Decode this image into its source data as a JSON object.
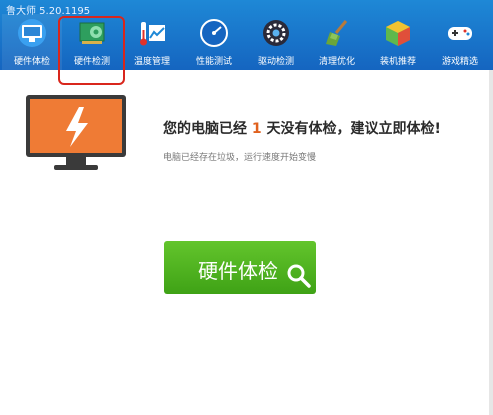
{
  "app": {
    "title": "鲁大师 5.20.1195"
  },
  "nav": [
    {
      "label": "硬件体检",
      "icon": "monitor-check-icon"
    },
    {
      "label": "硬件检测",
      "icon": "circuit-board-icon"
    },
    {
      "label": "温度管理",
      "icon": "thermometer-icon"
    },
    {
      "label": "性能测试",
      "icon": "speedometer-icon"
    },
    {
      "label": "驱动检测",
      "icon": "gear-driver-icon"
    },
    {
      "label": "清理优化",
      "icon": "broom-icon"
    },
    {
      "label": "装机推荐",
      "icon": "cube-icon"
    },
    {
      "label": "游戏精选",
      "icon": "gamepad-icon"
    }
  ],
  "main": {
    "title_pre": "您的电脑已经",
    "days": "1",
    "title_post": "天没有体检，建议立即体检!",
    "subtitle": "电脑已经存在垃圾，运行速度开始变慢",
    "check_button": "硬件体检"
  },
  "colors": {
    "topbar": "#1a75c9",
    "accent_number": "#e0611e",
    "button": "#4fb321",
    "highlight_box": "#d9261c"
  }
}
